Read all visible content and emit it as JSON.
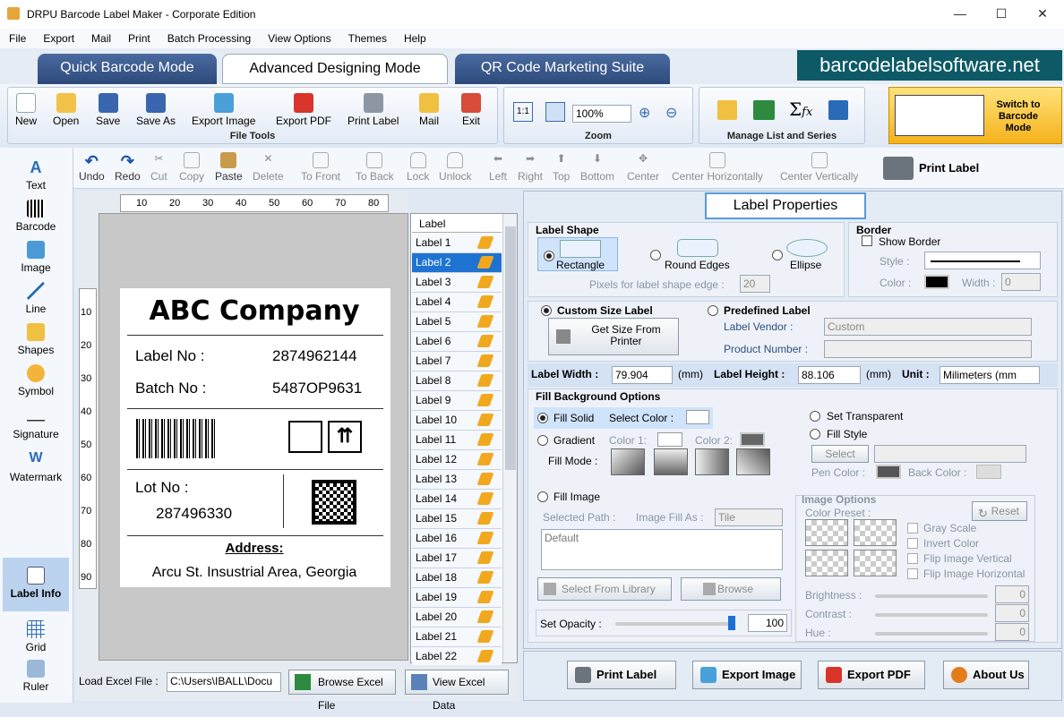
{
  "window": {
    "title": "DRPU Barcode Label Maker - Corporate Edition"
  },
  "menu": [
    "File",
    "Export",
    "Mail",
    "Print",
    "Batch Processing",
    "View Options",
    "Themes",
    "Help"
  ],
  "mode_tabs": [
    "Quick Barcode Mode",
    "Advanced Designing Mode",
    "QR Code Marketing Suite"
  ],
  "brand": "barcodelabelsoftware.net",
  "file_tools": {
    "title": "File Tools",
    "buttons": [
      "New",
      "Open",
      "Save",
      "Save As",
      "Export Image",
      "Export PDF",
      "Print Label",
      "Mail",
      "Exit"
    ]
  },
  "zoom": {
    "title": "Zoom",
    "value": "100%"
  },
  "manage": {
    "title": "Manage List and Series"
  },
  "switch_mode": "Switch to Barcode Mode",
  "left_tools": [
    "Text",
    "Barcode",
    "Image",
    "Line",
    "Shapes",
    "Symbol",
    "Signature",
    "Watermark",
    "Label Info",
    "Grid",
    "Ruler"
  ],
  "edit_tools": [
    "Undo",
    "Redo",
    "Cut",
    "Copy",
    "Paste",
    "Delete",
    "To Front",
    "To Back",
    "Lock",
    "Unlock",
    "Left",
    "Right",
    "Top",
    "Bottom",
    "Center",
    "Center Horizontally",
    "Center Vertically"
  ],
  "print_label": "Print Label",
  "ruler": {
    "h": [
      "10",
      "20",
      "30",
      "40",
      "50",
      "60",
      "70",
      "80"
    ],
    "v": [
      "10",
      "20",
      "30",
      "40",
      "50",
      "60",
      "70",
      "80",
      "90"
    ]
  },
  "label": {
    "company": "ABC Company",
    "label_no_caption": "Label No :",
    "label_no": "2874962144",
    "batch_no_caption": "Batch No :",
    "batch_no": "5487OP9631",
    "lot_no_caption": "Lot No :",
    "lot_no": "287496330",
    "address_caption": "Address:",
    "address": "Arcu St. Insustrial Area, Georgia"
  },
  "label_list": {
    "header": "Label",
    "items": [
      "Label 1",
      "Label 2",
      "Label 3",
      "Label 4",
      "Label 5",
      "Label 6",
      "Label 7",
      "Label 8",
      "Label 9",
      "Label 10",
      "Label 11",
      "Label 12",
      "Label 13",
      "Label 14",
      "Label 15",
      "Label 16",
      "Label 17",
      "Label 18",
      "Label 19",
      "Label 20",
      "Label 21",
      "Label 22"
    ],
    "selected": "Label 2"
  },
  "excel": {
    "caption": "Load Excel File :",
    "path": "C:\\Users\\IBALL\\Docu",
    "browse": "Browse Excel File",
    "view": "View Excel Data"
  },
  "props": {
    "title": "Label Properties",
    "shape": {
      "title": "Label Shape",
      "options": [
        "Rectangle",
        "Round Edges",
        "Ellipse"
      ],
      "pixels_caption": "Pixels for label shape edge :",
      "pixels": "20"
    },
    "border": {
      "title": "Border",
      "show": "Show Border",
      "style": "Style :",
      "color": "Color :",
      "width_caption": "Width :",
      "width": "0"
    },
    "size": {
      "custom": "Custom Size Label",
      "get_size": "Get Size From Printer",
      "predefined": "Predefined Label",
      "vendor_caption": "Label Vendor :",
      "vendor": "Custom",
      "product_caption": "Product Number :"
    },
    "dims": {
      "width_caption": "Label Width :",
      "width": "79.904",
      "height_caption": "Label Height :",
      "height": "88.106",
      "unit_mm": "(mm)",
      "unit_caption": "Unit :",
      "unit": "Milimeters (mm"
    },
    "fill": {
      "title": "Fill Background Options",
      "solid": "Fill Solid",
      "select_color": "Select Color :",
      "gradient": "Gradient",
      "color1": "Color 1:",
      "color2": "Color 2:",
      "fill_mode": "Fill Mode :",
      "transparent": "Set Transparent",
      "fill_style": "Fill Style",
      "select": "Select",
      "pen_color": "Pen Color :",
      "back_color": "Back Color :"
    },
    "image": {
      "fill_image": "Fill Image",
      "selected_path": "Selected Path :",
      "fill_as": "Image Fill As :",
      "fill_as_value": "Tile",
      "default": "Default",
      "library": "Select From Library",
      "browse": "Browse"
    },
    "image_options": {
      "title": "Image Options",
      "preset": "Color Preset :",
      "reset": "Reset",
      "checks": [
        "Gray Scale",
        "Invert Color",
        "Flip Image Vertical",
        "Flip Image Horizontal"
      ],
      "brightness": "Brightness :",
      "contrast": "Contrast :",
      "hue": "Hue :",
      "values": [
        "0",
        "0",
        "0"
      ]
    },
    "opacity": {
      "caption": "Set Opacity :",
      "value": "100"
    }
  },
  "bottom_buttons": [
    "Print Label",
    "Export Image",
    "Export PDF",
    "About Us"
  ]
}
